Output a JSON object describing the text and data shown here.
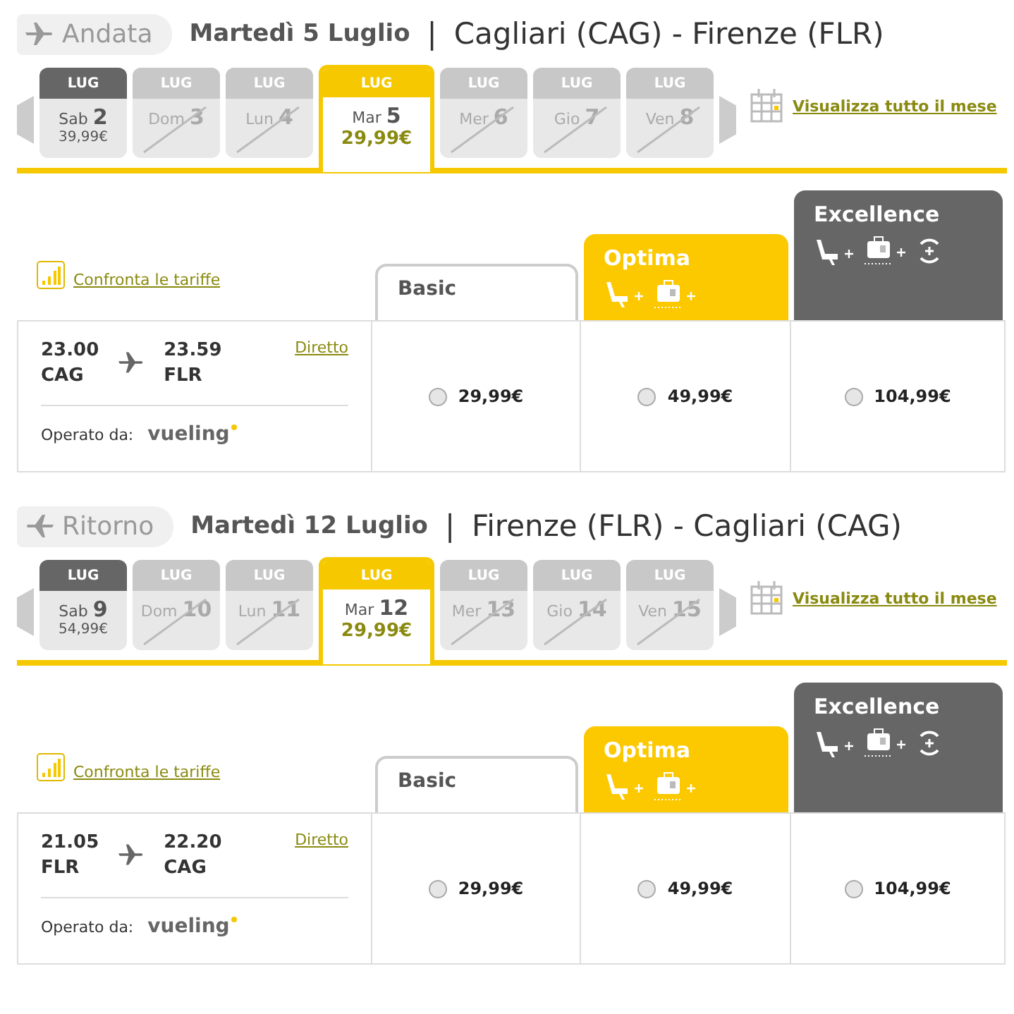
{
  "legs": [
    {
      "leg_label": "Andata",
      "date": "Martedì 5 Luglio",
      "separator": "|",
      "route": "Cagliari (CAG) - Firenze (FLR)",
      "days": [
        {
          "month": "LUG",
          "weekday": "Sab",
          "day": "2",
          "price": "39,99€",
          "available": true,
          "selected": false
        },
        {
          "month": "LUG",
          "weekday": "Dom",
          "day": "3",
          "available": false,
          "selected": false
        },
        {
          "month": "LUG",
          "weekday": "Lun",
          "day": "4",
          "available": false,
          "selected": false
        },
        {
          "month": "LUG",
          "weekday": "Mar",
          "day": "5",
          "price": "29,99€",
          "available": true,
          "selected": true
        },
        {
          "month": "LUG",
          "weekday": "Mer",
          "day": "6",
          "available": false,
          "selected": false
        },
        {
          "month": "LUG",
          "weekday": "Gio",
          "day": "7",
          "available": false,
          "selected": false
        },
        {
          "month": "LUG",
          "weekday": "Ven",
          "day": "8",
          "available": false,
          "selected": false
        }
      ],
      "month_link": "Visualizza tutto il mese",
      "compare_link": "Confronta le tariffe",
      "fares": [
        {
          "kind": "basic",
          "name": "Basic"
        },
        {
          "kind": "optima",
          "name": "Optima"
        },
        {
          "kind": "excellence",
          "name": "Excellence"
        }
      ],
      "flight": {
        "depart_time": "23.00",
        "depart_code": "CAG",
        "arrive_time": "23.59",
        "arrive_code": "FLR",
        "type": "Diretto",
        "operated_label": "Operato da:",
        "carrier": "vueling",
        "prices": [
          {
            "price": "29,99€",
            "selected": false
          },
          {
            "price": "49,99€",
            "selected": false
          },
          {
            "price": "104,99€",
            "selected": false
          }
        ]
      }
    },
    {
      "leg_label": "Ritorno",
      "date": "Martedì 12 Luglio",
      "separator": "|",
      "route": "Firenze (FLR) - Cagliari (CAG)",
      "days": [
        {
          "month": "LUG",
          "weekday": "Sab",
          "day": "9",
          "price": "54,99€",
          "available": true,
          "selected": false
        },
        {
          "month": "LUG",
          "weekday": "Dom",
          "day": "10",
          "available": false,
          "selected": false
        },
        {
          "month": "LUG",
          "weekday": "Lun",
          "day": "11",
          "available": false,
          "selected": false
        },
        {
          "month": "LUG",
          "weekday": "Mar",
          "day": "12",
          "price": "29,99€",
          "available": true,
          "selected": true
        },
        {
          "month": "LUG",
          "weekday": "Mer",
          "day": "13",
          "available": false,
          "selected": false
        },
        {
          "month": "LUG",
          "weekday": "Gio",
          "day": "14",
          "available": false,
          "selected": false
        },
        {
          "month": "LUG",
          "weekday": "Ven",
          "day": "15",
          "available": false,
          "selected": false
        }
      ],
      "month_link": "Visualizza tutto il mese",
      "compare_link": "Confronta le tariffe",
      "fares": [
        {
          "kind": "basic",
          "name": "Basic"
        },
        {
          "kind": "optima",
          "name": "Optima"
        },
        {
          "kind": "excellence",
          "name": "Excellence"
        }
      ],
      "flight": {
        "depart_time": "21.05",
        "depart_code": "FLR",
        "arrive_time": "22.20",
        "arrive_code": "CAG",
        "type": "Diretto",
        "operated_label": "Operato da:",
        "carrier": "vueling",
        "prices": [
          {
            "price": "29,99€",
            "selected": false
          },
          {
            "price": "49,99€",
            "selected": false
          },
          {
            "price": "104,99€",
            "selected": false
          }
        ]
      }
    }
  ]
}
